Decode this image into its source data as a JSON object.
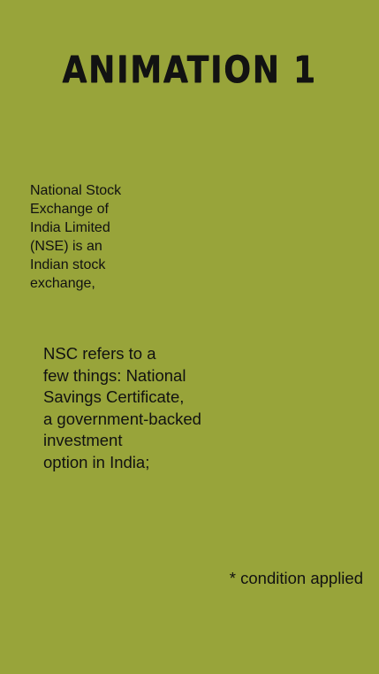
{
  "title": "ANIMATION 1",
  "nse_paragraph": "National Stock\nExchange of\nIndia Limited\n(NSE) is an\nIndian stock\nexchange,",
  "nsc_paragraph": "NSC refers to a\nfew things: National\nSavings Certificate,\na government-backed\ninvestment\n option in India;",
  "condition_note": "* condition applied",
  "colors": {
    "background": "#98a43a",
    "text": "#111111"
  }
}
